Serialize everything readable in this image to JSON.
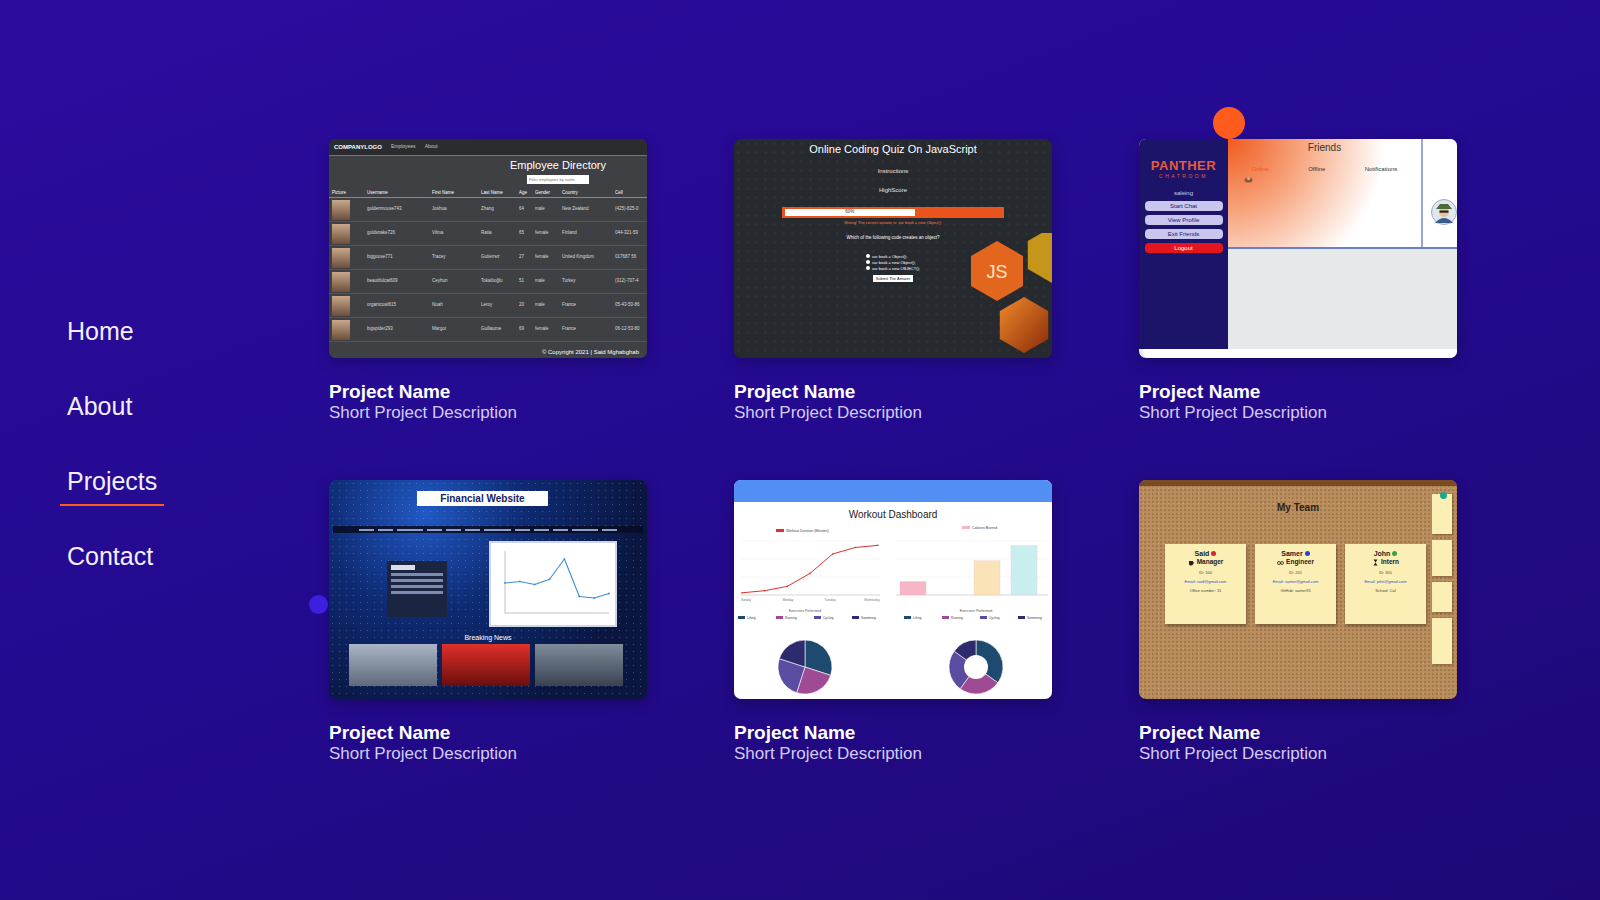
{
  "nav": {
    "items": [
      {
        "label": "Home",
        "selected": false
      },
      {
        "label": "About",
        "selected": false
      },
      {
        "label": "Projects",
        "selected": true
      },
      {
        "label": "Contact",
        "selected": false
      }
    ]
  },
  "projects": [
    {
      "title": "Project Name",
      "description": "Short Project Description",
      "kind": "directory",
      "preview": {
        "brand": "COMPANYLOGO",
        "links": [
          "Employees",
          "About"
        ],
        "heading": "Employee Directory",
        "search": "Filter employees by name",
        "columns": [
          "Picture",
          "Username",
          "First Name",
          "Last Name",
          "Age",
          "Gender",
          "Country",
          "Cell"
        ],
        "rows": [
          [
            "goldenmouse743",
            "Joshua",
            "Zhang",
            "64",
            "male",
            "New Zealand",
            "(425)-825-0"
          ],
          [
            "goldsnake726",
            "Vilma",
            "Ratia",
            "65",
            "female",
            "Finland",
            "044-321-59"
          ],
          [
            "biggoose771",
            "Tracey",
            "Gutierrez",
            "27",
            "female",
            "United Kingdom",
            "017687 56"
          ],
          [
            "beautifulcat609",
            "Ceyhun",
            "Tokatlıoğlu",
            "51",
            "male",
            "Turkey",
            "(312)-707-4"
          ],
          [
            "organicowl615",
            "Noah",
            "Leroy",
            "20",
            "male",
            "France",
            "05-43-50-86"
          ],
          [
            "bigspider293",
            "Margot",
            "Guillaume",
            "69",
            "female",
            "France",
            "06-12-53-80"
          ]
        ],
        "footer": "© Copyright 2021 | Said Mghabghab"
      }
    },
    {
      "title": "Project Name",
      "description": "Short Project Description",
      "kind": "quiz",
      "preview": {
        "heading": "Online Coding Quiz On JavaScript",
        "links": [
          "Instructions",
          "HighScore"
        ],
        "progress": {
          "level": 0.6,
          "reading": "60%"
        },
        "feedback": "Wrong! The correct answer is: var book = new Object();",
        "question": "Which of the following code creates an object?",
        "options": [
          {
            "label": "var book = Object();",
            "selected": false
          },
          {
            "label": "var book = new Object();",
            "selected": false
          },
          {
            "label": "var book = new OBJECT();",
            "selected": false
          }
        ],
        "button": "Submit The Answer",
        "badge": "JS"
      }
    },
    {
      "title": "Project Name",
      "description": "Short Project Description",
      "kind": "chat",
      "preview": {
        "logo": "PANTHER",
        "subtitle": "CHATROOM",
        "user": "saleing",
        "buttons": [
          {
            "label": "Start Chat",
            "kind": "normal"
          },
          {
            "label": "View Profile",
            "kind": "normal"
          },
          {
            "label": "Exit Friends",
            "kind": "normal"
          },
          {
            "label": "Logout",
            "kind": "danger"
          }
        ],
        "heading": "Friends",
        "tabs": [
          {
            "label": "Online",
            "selected": true
          },
          {
            "label": "Offline",
            "selected": false
          },
          {
            "label": "Notifications",
            "selected": false
          }
        ]
      }
    },
    {
      "title": "Project Name",
      "description": "Short Project Description",
      "kind": "finance",
      "preview": {
        "heading": "Financial Website",
        "chart": {
          "values": [
            40,
            42,
            38,
            45,
            72,
            22,
            20,
            26
          ]
        },
        "news": "Breaking News"
      }
    },
    {
      "title": "Project Name",
      "description": "Short Project Description",
      "kind": "dashboard",
      "preview": {
        "heading": "Workout Dashboard",
        "line": {
          "legend": "Workout Duration (Minutes)",
          "color": "#e0312d",
          "values": [
            2,
            4,
            8,
            20,
            38,
            44,
            46
          ],
          "ticks": [
            "Sunday",
            "Monday",
            "Tuesday",
            "Wednesday"
          ]
        },
        "bars": {
          "legend": "Calories Burned",
          "items": [
            {
              "value": 15,
              "color": "#f7b6c6"
            },
            {
              "value": 0,
              "color": "#f7b6c6"
            },
            {
              "value": 38,
              "color": "#fbe3b8"
            },
            {
              "value": 55,
              "color": "#c9eef0"
            }
          ]
        },
        "pies": [
          {
            "title": "Exercises Performed",
            "kind": "pie",
            "slices": [
              {
                "label": "Lifting",
                "value": 30,
                "color": "#1d4a6e"
              },
              {
                "label": "Running",
                "value": 25,
                "color": "#9e4a94"
              },
              {
                "label": "Cycling",
                "value": 25,
                "color": "#5a4ca0"
              },
              {
                "label": "Swimming",
                "value": 20,
                "color": "#2d2a6e"
              }
            ]
          },
          {
            "title": "Exercises Performed",
            "kind": "donut",
            "slices": [
              {
                "label": "Lifting",
                "value": 35,
                "color": "#1d4a6e"
              },
              {
                "label": "Running",
                "value": 25,
                "color": "#9e4a94"
              },
              {
                "label": "Cycling",
                "value": 25,
                "color": "#5a4ca0"
              },
              {
                "label": "Swimming",
                "value": 15,
                "color": "#2d2a6e"
              }
            ]
          }
        ]
      }
    },
    {
      "title": "Project Name",
      "description": "Short Project Description",
      "kind": "team",
      "preview": {
        "heading": "My Team",
        "members": [
          {
            "name": "Said",
            "role": "Manager",
            "pin": "#d8262c",
            "lines": [
              "ID: 100",
              "Email: said@gmail.com",
              "Office number: 15"
            ]
          },
          {
            "name": "Samer",
            "role": "Engineer",
            "pin": "#2b46c4",
            "lines": [
              "ID: 201",
              "Email: samer@gmail.com",
              "GitHub: samer95"
            ]
          },
          {
            "name": "John",
            "role": "Intern",
            "pin": "#3aa33a",
            "lines": [
              "ID: 301",
              "Email: john@gmail.com",
              "School: Cal"
            ]
          }
        ]
      }
    }
  ]
}
